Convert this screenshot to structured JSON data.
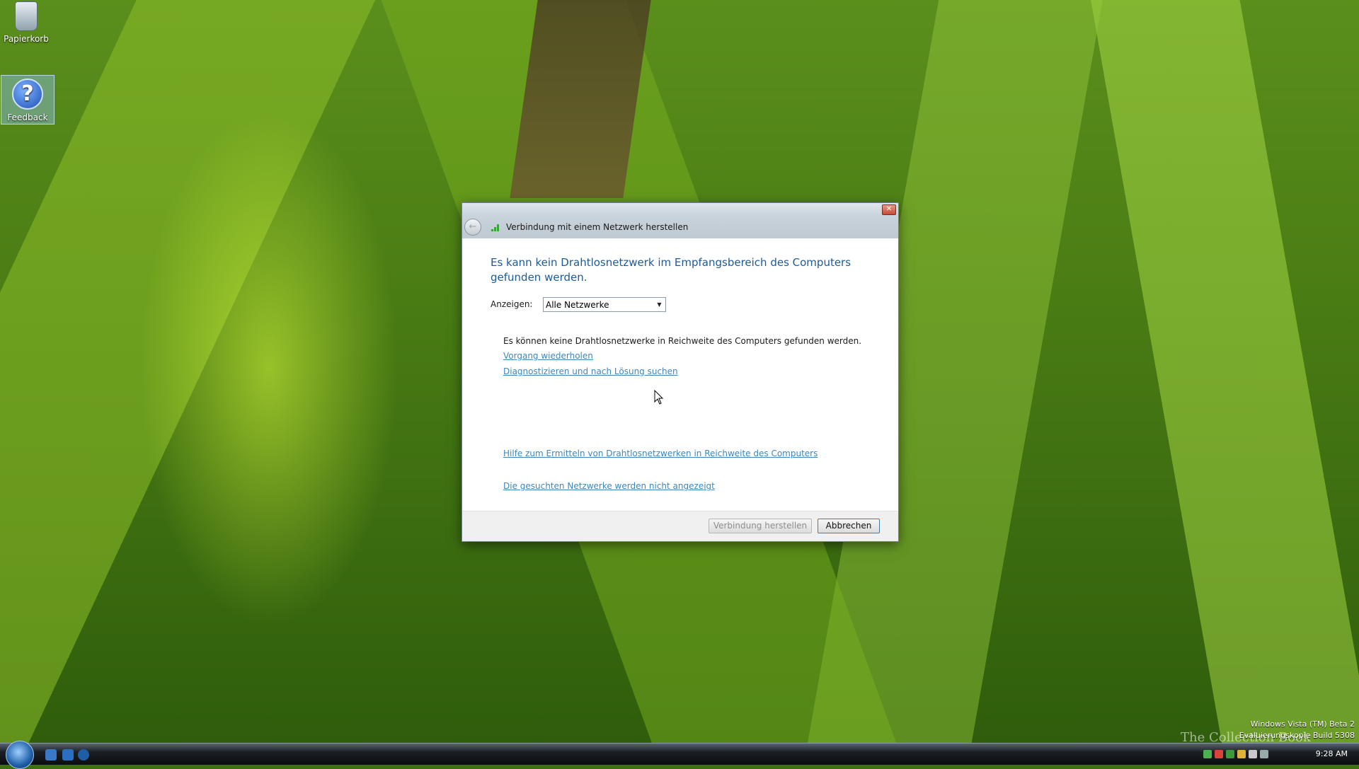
{
  "desktop": {
    "icons": [
      {
        "label": "Papierkorb"
      },
      {
        "label": "Feedback"
      }
    ]
  },
  "dialog": {
    "title": "Verbindung mit einem Netzwerk herstellen",
    "heading": "Es kann kein Drahtlosnetzwerk im Empfangsbereich des Computers gefunden werden.",
    "show_label": "Anzeigen:",
    "show_select": {
      "value": "Alle Netzwerke"
    },
    "info_text": "Es können keine Drahtlosnetzwerke in Reichweite des Computers gefunden werden.",
    "links": {
      "retry": "Vorgang wiederholen",
      "diagnose": "Diagnostizieren und nach Lösung suchen",
      "help": "Hilfe zum Ermitteln von Drahtlosnetzwerken in Reichweite des Computers",
      "not_shown": "Die gesuchten Netzwerke werden nicht angezeigt"
    },
    "buttons": {
      "connect": "Verbindung herstellen",
      "cancel": "Abbrechen"
    },
    "close_glyph": "✕",
    "back_glyph": "←"
  },
  "taskbar": {
    "clock": "9:28 AM"
  },
  "watermark": {
    "line1": "Windows Vista (TM) Beta 2",
    "line2": "Evaluierungskopie Build 5308",
    "brand": "The Collection Book"
  },
  "icons": {
    "recycle": "recycle-bin-icon",
    "feedback": "help-question-icon",
    "wifi": "wireless-signal-icon"
  },
  "colors": {
    "heading": "#1e5a96",
    "link": "#3f86b8",
    "close": "#c24a32"
  }
}
